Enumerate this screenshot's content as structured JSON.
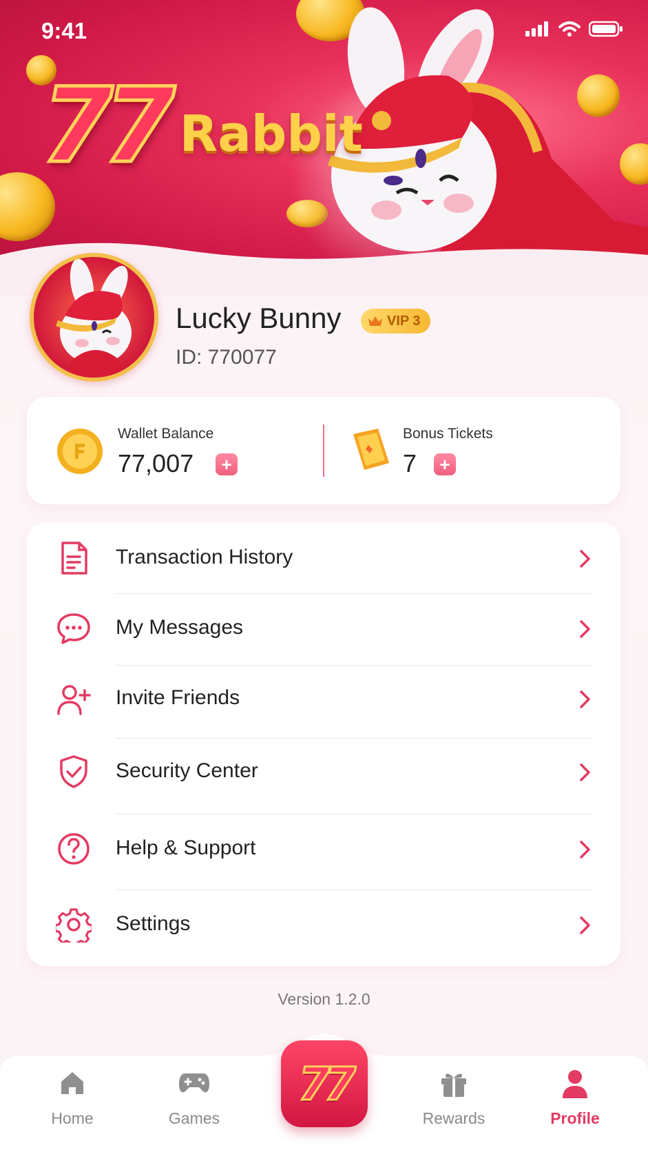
{
  "status_bar": {
    "time": "9:41"
  },
  "hero": {
    "logo_number": "77",
    "logo_word": "Rabbit"
  },
  "profile": {
    "name": "Lucky Bunny",
    "vip": "VIP 3",
    "id": "ID: 770077"
  },
  "wallet": {
    "balance_label": "Wallet Balance",
    "balance_value": "77,007",
    "tickets_label": "Bonus Tickets",
    "tickets_value": "7",
    "plus": "+"
  },
  "menu": [
    {
      "label": "Transaction History",
      "icon": "document-icon"
    },
    {
      "label": "My Messages",
      "icon": "chat-bubble-icon"
    },
    {
      "label": "Invite Friends",
      "icon": "add-user-icon"
    },
    {
      "label": "Security Center",
      "icon": "shield-check-icon"
    },
    {
      "label": "Help & Support",
      "icon": "question-circle-icon"
    },
    {
      "label": "Settings",
      "icon": "gear-icon"
    }
  ],
  "version": "Version 1.2.0",
  "tabs": [
    {
      "label": "Home",
      "icon": "home-icon"
    },
    {
      "label": "Games",
      "icon": "gamepad-icon"
    },
    {
      "label": "Rewards",
      "icon": "gift-icon"
    },
    {
      "label": "Profile",
      "icon": "person-icon",
      "active": true
    }
  ],
  "center_button": {
    "label": "77"
  },
  "colors": {
    "accent": "#e33b63",
    "gold": "#f7b833",
    "hero": "#d11a48"
  }
}
